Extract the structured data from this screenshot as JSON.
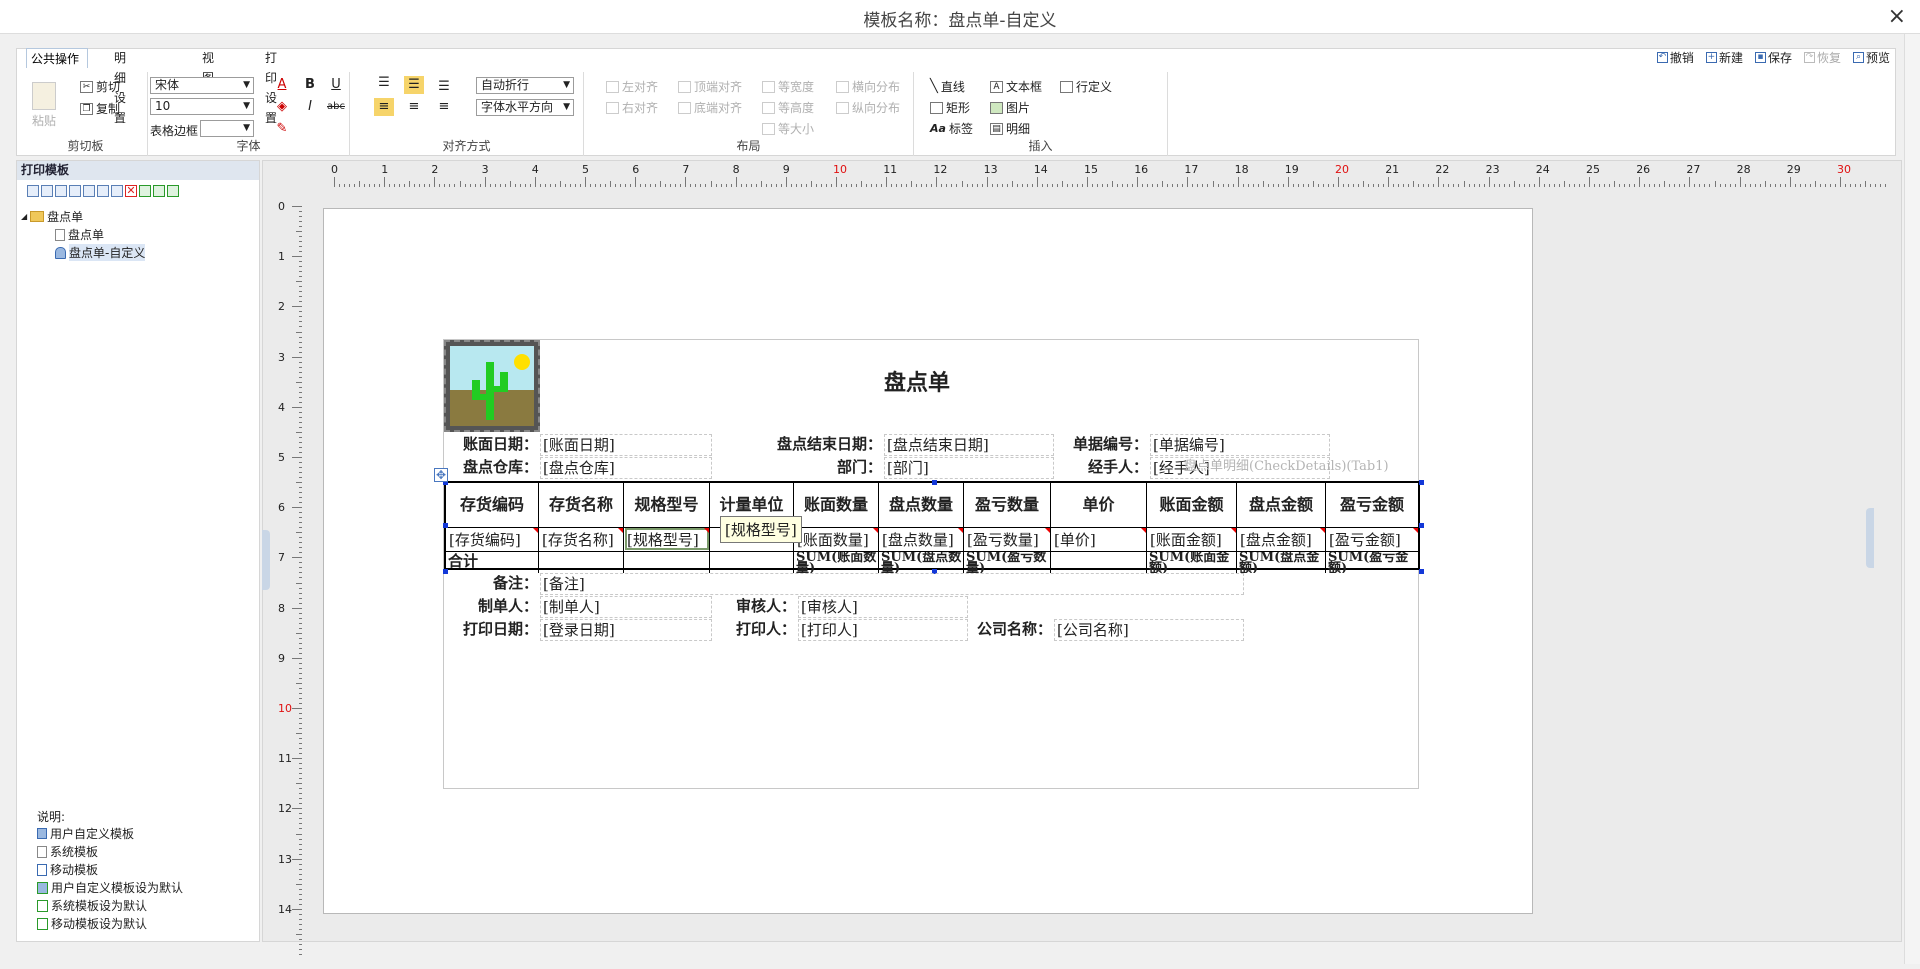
{
  "window": {
    "title": "模板名称：盘点单-自定义",
    "close_icon": "×"
  },
  "tabs": [
    "公共操作",
    "明细设置",
    "视图",
    "打印设置"
  ],
  "quick_actions": [
    {
      "label": "撤销",
      "icon": "undo-icon",
      "enabled": true
    },
    {
      "label": "新建",
      "icon": "new-icon",
      "enabled": true
    },
    {
      "label": "保存",
      "icon": "save-icon",
      "enabled": true
    },
    {
      "label": "恢复",
      "icon": "redo-icon",
      "enabled": false
    },
    {
      "label": "预览",
      "icon": "preview-icon",
      "enabled": true
    }
  ],
  "ribbon": {
    "clipboard": {
      "group": "剪切板",
      "paste": "粘贴",
      "cut": "剪切",
      "copy": "复制"
    },
    "font": {
      "group": "字体",
      "font_name": "宋体",
      "font_size": "10",
      "table_border_label": "表格边框",
      "table_border_value": "",
      "bold": "B",
      "italic": "I",
      "underline": "U",
      "strike": "abc",
      "color": "A"
    },
    "align": {
      "group": "对齐方式",
      "wrap": "自动折行",
      "halign": "字体水平方向"
    },
    "layout": {
      "group": "布局",
      "items": [
        "左对齐",
        "顶端对齐",
        "等宽度",
        "横向分布",
        "右对齐",
        "底端对齐",
        "等高度",
        "纵向分布",
        "等大小"
      ]
    },
    "insert": {
      "group": "插入",
      "items": [
        "直线",
        "文本框",
        "行定义",
        "矩形",
        "图片",
        "标签",
        "明细"
      ]
    }
  },
  "left_panel": {
    "header": "打印模板",
    "tree_root": "盘点单",
    "tree_children": [
      "盘点单",
      "盘点单-自定义"
    ],
    "selected": "盘点单-自定义",
    "legend_title": "说明:",
    "legend": [
      "用户自定义模板",
      "系统模板",
      "移动模板",
      "用户自定义模板设为默认",
      "系统模板设为默认",
      "移动模板设为默认"
    ]
  },
  "ruler": {
    "h_labels": [
      "0",
      "1",
      "2",
      "3",
      "4",
      "5",
      "6",
      "7",
      "8",
      "9",
      "10",
      "11",
      "12",
      "13",
      "14",
      "15",
      "16",
      "17",
      "18",
      "19",
      "20",
      "21",
      "22",
      "23",
      "24",
      "25",
      "26",
      "27",
      "28",
      "29",
      "30"
    ],
    "h_red": [
      "10",
      "20",
      "30"
    ],
    "v_labels": [
      "0",
      "1",
      "2",
      "3",
      "4",
      "5",
      "6",
      "7",
      "8",
      "9",
      "10",
      "11",
      "12",
      "13",
      "14"
    ],
    "v_red": [
      "10"
    ]
  },
  "report": {
    "title": "盘点单",
    "row1": {
      "l1": "账面日期：",
      "f1": "[账面日期]",
      "l2": "盘点结束日期：",
      "f2": "[盘点结束日期]",
      "l3": "单据编号：",
      "f3": "[单据编号]"
    },
    "row2": {
      "l1": "盘点仓库：",
      "f1": "[盘点仓库]",
      "l2": "部门：",
      "f2": "[部门]",
      "l3": "经手人：",
      "f3": "[经手人]",
      "overlay": "盘点单明细(CheckDetails)(Tab1)"
    },
    "columns": [
      "存货编码",
      "存货名称",
      "规格型号",
      "计量单位",
      "账面数量",
      "盘点数量",
      "盈亏数量",
      "单价",
      "账面金额",
      "盘点金额",
      "盈亏金额"
    ],
    "detail": [
      "[存货编码]",
      "[存货名称]",
      "[规格型号]",
      "",
      "[账面数量]",
      "[盘点数量]",
      "[盈亏数量]",
      "[单价]",
      "[账面金额]",
      "[盘点金额]",
      "[盈亏金额]"
    ],
    "sum_label": "合计",
    "sums": [
      "",
      "",
      "",
      "SUM(账面数量)",
      "SUM(盘点数量)",
      "SUM(盈亏数量)",
      "",
      "SUM(账面金额)",
      "SUM(盘点金额)",
      "SUM(盈亏金额)"
    ],
    "tooltip": "[规格型号]",
    "footer": {
      "remark_label": "备注：",
      "remark": "[备注]",
      "maker_label": "制单人：",
      "maker": "[制单人]",
      "checker_label": "审核人：",
      "checker": "[审核人]",
      "print_date_label": "打印日期：",
      "print_date": "[登录日期]",
      "printer_label": "打印人：",
      "printer": "[打印人]",
      "company_label": "公司名称：",
      "company": "[公司名称]"
    }
  }
}
